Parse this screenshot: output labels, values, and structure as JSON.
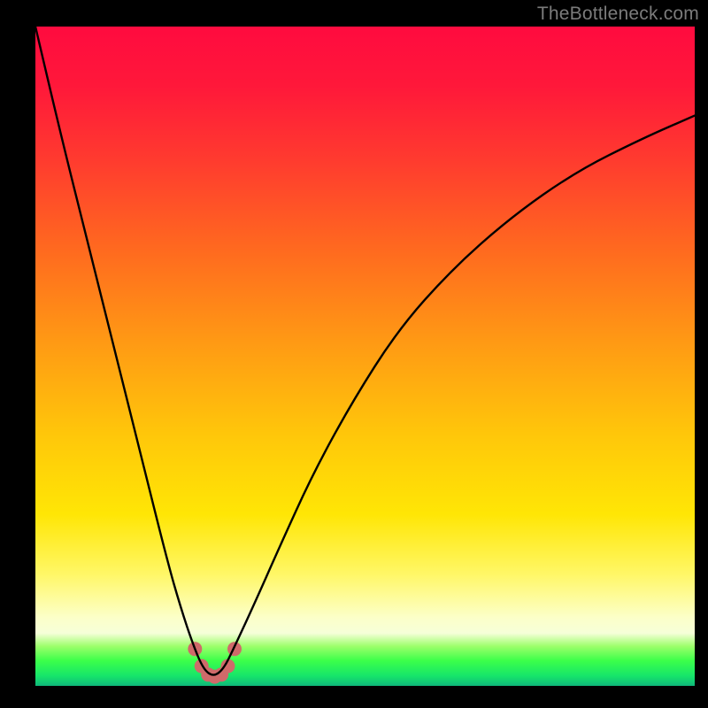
{
  "watermark": "TheBottleneck.com",
  "chart_data": {
    "type": "line",
    "title": "",
    "xlabel": "",
    "ylabel": "",
    "xlim": [
      0,
      100
    ],
    "ylim": [
      0,
      100
    ],
    "grid": false,
    "legend": false,
    "note": "Axes are unlabeled in the source image; x/y treated as 0–100 percent of plot area. Single V-shaped curve with minimum near x≈27; small salmon-colored marker cluster at the minimum.",
    "series": [
      {
        "name": "curve",
        "color": "#000000",
        "x": [
          0,
          4,
          8,
          12,
          16,
          20,
          22,
          24,
          25.5,
          27,
          28.5,
          30,
          33,
          37,
          42,
          48,
          55,
          63,
          72,
          82,
          92,
          100
        ],
        "y": [
          100,
          83,
          67,
          51,
          35,
          19,
          12,
          6,
          2.5,
          1.4,
          2.5,
          5.5,
          12,
          21,
          32,
          43,
          54,
          63,
          71,
          78,
          83,
          86.5
        ]
      }
    ],
    "markers": {
      "name": "min-cluster",
      "color": "#cf6a6a",
      "radius_px": 8,
      "points": [
        {
          "x": 24.2,
          "y": 5.6
        },
        {
          "x": 25.2,
          "y": 3.0
        },
        {
          "x": 26.2,
          "y": 1.7
        },
        {
          "x": 27.2,
          "y": 1.4
        },
        {
          "x": 28.2,
          "y": 1.7
        },
        {
          "x": 29.2,
          "y": 3.0
        },
        {
          "x": 30.2,
          "y": 5.6
        }
      ]
    }
  }
}
